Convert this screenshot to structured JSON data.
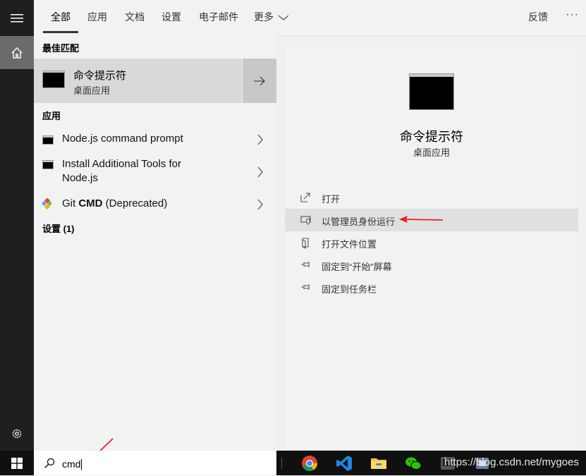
{
  "tabs": [
    "全部",
    "应用",
    "文档",
    "设置",
    "电子邮件",
    "更多"
  ],
  "header": {
    "feedback": "反馈",
    "more_options": "···"
  },
  "results": {
    "best_match_title": "最佳匹配",
    "best_match": {
      "name": "命令提示符",
      "type": "桌面应用"
    },
    "apps_title": "应用",
    "apps": [
      {
        "label": "Node.js command prompt"
      },
      {
        "label_line1": "Install Additional Tools for",
        "label_line2": "Node.js"
      },
      {
        "label_prefix": "Git ",
        "label_bold": "CMD",
        "label_suffix": " (Deprecated)"
      }
    ],
    "settings_title": "设置 (1)"
  },
  "details": {
    "name": "命令提示符",
    "type": "桌面应用",
    "actions": [
      "打开",
      "以管理员身份运行",
      "打开文件位置",
      "固定到“开始”屏幕",
      "固定到任务栏"
    ]
  },
  "search": {
    "query": "cmd"
  },
  "taskbar": {
    "watermark": "https://blog.csdn.net/mygoes"
  },
  "colors": {
    "annotation_arrow": "#e8202a"
  }
}
